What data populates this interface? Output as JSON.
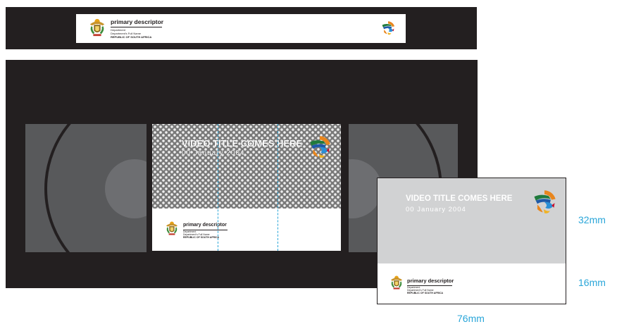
{
  "spine": {
    "descriptor": "primary descriptor",
    "dept_line1": "Department",
    "dept_line2": "Department's Full Name",
    "country": "REPUBLIC OF SOUTH AFRICA"
  },
  "front_label": {
    "video_title": "VIDEO TITLE COMES HERE",
    "date": "00 January 2004",
    "descriptor": "primary descriptor",
    "dept_line1": "Department",
    "dept_line2": "Department's Full Name",
    "country": "REPUBLIC OF SOUTH AFRICA"
  },
  "spec_card": {
    "video_title": "VIDEO TITLE COMES HERE",
    "date": "00 January 2004",
    "descriptor": "primary descriptor",
    "dept_line1": "Department",
    "dept_line2": "Department's Full Name",
    "country": "REPUBLIC OF SOUTH AFRICA"
  },
  "dimensions": {
    "upper_height": "32mm",
    "lower_height": "16mm",
    "width": "76mm"
  },
  "colors": {
    "cassette": "#231f20",
    "reel_window": "#58595b",
    "dimension_text": "#2aa6d9",
    "card_upper": "#d1d2d3"
  },
  "icons": [
    "coat-of-arms-icon",
    "tourism-emblem-icon"
  ]
}
